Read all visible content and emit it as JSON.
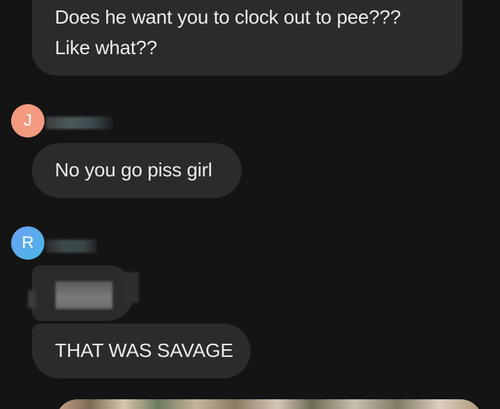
{
  "messages": [
    {
      "id": "m1",
      "lines": [
        "Does he want you to clock out to pee???",
        "Like what??"
      ]
    },
    {
      "id": "m2",
      "sender_initial": "J",
      "text": "No you go piss girl"
    },
    {
      "id": "m3",
      "sender_initial": "R",
      "text_redacted": true
    },
    {
      "id": "m4",
      "text": "THAT WAS SAVAGE"
    }
  ],
  "colors": {
    "background": "#141414",
    "bubble": "#2b2b2b",
    "text": "#ececec",
    "avatar_j": "#f39a80",
    "avatar_r": "#5aa9ec"
  },
  "attachment": {
    "type": "image-preview"
  }
}
